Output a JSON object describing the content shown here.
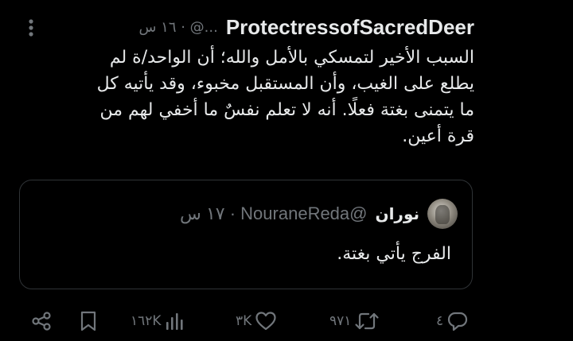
{
  "tweet": {
    "author_name": "ProtectressofSacredDeer",
    "author_meta": "...@ · ١٦ س",
    "more_icon": "more-vertical-icon",
    "text": "السبب الأخير لتمسكي بالأمل والله؛ أن الواحد/ة لم\nيطلع على الغيب، وأن المستقبل مخبوء، وقد يأتيه كل\nما يتمنى بغتة فعلًا. أنه لا تعلم نفسٌ ما أخفي لهم من\nقرة أعين."
  },
  "quote": {
    "avatar_icon": "user-avatar",
    "author_name": "نوران",
    "author_meta": "@NouraneReda · ١٧ س",
    "text": "الفرج يأتي بغتة."
  },
  "actions": {
    "reply_count": "٤",
    "retweet_count": "٩٧١",
    "like_count": "٣K",
    "views_count": "١٦٢K",
    "icons": {
      "reply": "reply-icon",
      "retweet": "retweet-icon",
      "like": "heart-icon",
      "views": "views-bar-chart-icon",
      "bookmark": "bookmark-icon",
      "share": "share-icon"
    }
  },
  "colors": {
    "background": "#000000",
    "primary_text": "#e7e9ea",
    "secondary_text": "#71767b",
    "border": "#2f3336"
  }
}
